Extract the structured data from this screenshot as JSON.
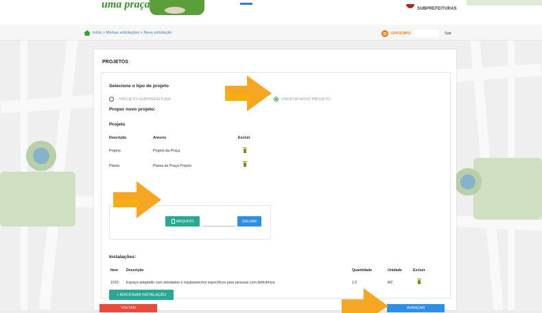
{
  "header": {
    "logo_text": "uma praça",
    "subprefeituras_label": "SUBPREFEITURAS"
  },
  "breadcrumb": {
    "home": "Início",
    "sep": ">",
    "item1": "Minhas solicitações",
    "item2": "Nova solicitação"
  },
  "user": {
    "cpf_label": "CPF/CNPJ:",
    "cpf_value": "",
    "logout": "Sair"
  },
  "page": {
    "title": "PROJETOS",
    "select_type_heading": "Selecione o tipo de projeto",
    "option1": "PROJETO SUBPREFEITURA",
    "option2": "PROPOR NOVO PROJETO",
    "option_selected": "option2",
    "propose_heading": "Propor novo projeto:",
    "project_subheading": "Projeto"
  },
  "attachments_table": {
    "headers": [
      "Descrição",
      "Anexos",
      "Excluir"
    ],
    "rows": [
      {
        "descricao": "Projeto",
        "anexo": "Projeto da Praça"
      },
      {
        "descricao": "Planta",
        "anexo": "Planta da Praça Projeto"
      }
    ]
  },
  "upload": {
    "arquivo_label": "ARQUIVO",
    "salvar_label": "SALVAR"
  },
  "installations": {
    "heading": "Instalações:",
    "headers": [
      "Item",
      "Descrição",
      "Quantidade",
      "Unidade",
      "Excluir"
    ],
    "rows": [
      {
        "item": "1015",
        "descricao": "Espaço adaptado com atividades e equipamentos específicos para pessoas com deficiência",
        "quantidade": "1.0",
        "unidade": "M2"
      }
    ],
    "add_label": "+ ADICIONAR INSTALAÇÃO"
  },
  "footer": {
    "back_label": "VOLTAR",
    "next_label": "AVANÇAR"
  },
  "colors": {
    "teal": "#2aa893",
    "blue": "#2f8fe6",
    "red": "#e84a3c",
    "orange_arrow": "#f5a623",
    "trash_olive": "#7b8e12"
  }
}
